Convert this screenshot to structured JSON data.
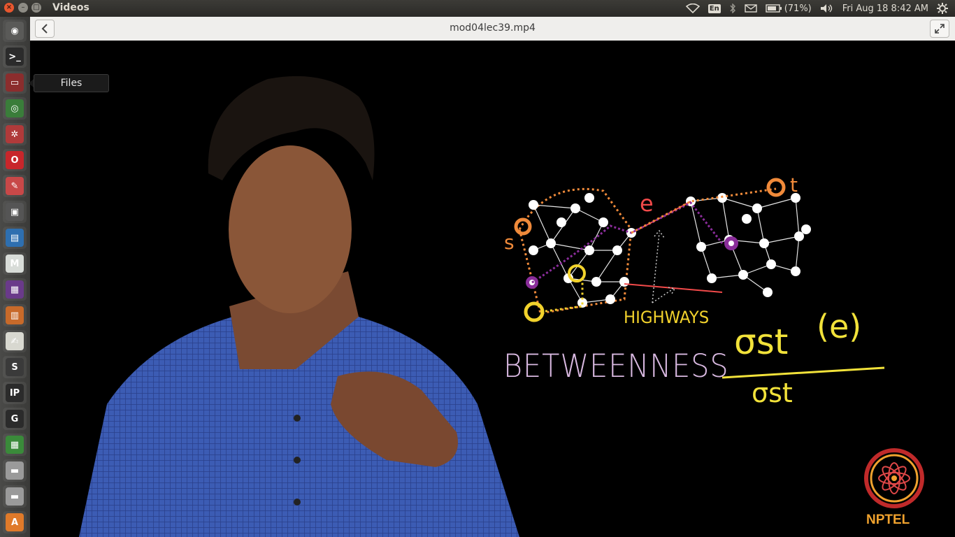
{
  "window": {
    "title": "Videos",
    "file_title": "mod04lec39.mp4"
  },
  "tray": {
    "lang": "En",
    "battery": "(71%)",
    "datetime": "Fri Aug 18  8:42 AM"
  },
  "launcher": {
    "tooltip": "Files",
    "items": [
      {
        "name": "dash-icon",
        "color": "#5a5a58",
        "glyph": "◉"
      },
      {
        "name": "terminal-icon",
        "color": "#2b2b2b",
        "glyph": ">_"
      },
      {
        "name": "files-icon",
        "color": "#8b2d2d",
        "glyph": "▭"
      },
      {
        "name": "chrome-icon",
        "color": "#3a7d3a",
        "glyph": "◎"
      },
      {
        "name": "settings-icon",
        "color": "#b03a3a",
        "glyph": "✲"
      },
      {
        "name": "opera-icon",
        "color": "#c8262b",
        "glyph": "O"
      },
      {
        "name": "pdf-reader-icon",
        "color": "#c84848",
        "glyph": "✎"
      },
      {
        "name": "video-editor-icon",
        "color": "#555555",
        "glyph": "▣"
      },
      {
        "name": "writer-icon",
        "color": "#2e6fb0",
        "glyph": "▤"
      },
      {
        "name": "gmail-icon",
        "color": "#d8dcd8",
        "glyph": "M"
      },
      {
        "name": "media-icon",
        "color": "#6a3a8a",
        "glyph": "▦"
      },
      {
        "name": "impress-icon",
        "color": "#c86a2a",
        "glyph": "▥"
      },
      {
        "name": "text-editor-icon",
        "color": "#d8d8d0",
        "glyph": "✍"
      },
      {
        "name": "sublime-icon",
        "color": "#3a3a3a",
        "glyph": "S"
      },
      {
        "name": "ipython-icon",
        "color": "#2b2b2b",
        "glyph": "IP"
      },
      {
        "name": "gephi-icon",
        "color": "#2b2b2b",
        "glyph": "G"
      },
      {
        "name": "calc-icon",
        "color": "#3a8a3a",
        "glyph": "▦"
      },
      {
        "name": "drive-icon",
        "color": "#9a9a9a",
        "glyph": "▬"
      },
      {
        "name": "drive2-icon",
        "color": "#9a9a9a",
        "glyph": "▬"
      },
      {
        "name": "software-center-icon",
        "color": "#e07a2a",
        "glyph": "A"
      }
    ]
  },
  "video": {
    "title_word": "BETWEENNESS",
    "label_highways": "HIGHWAYS",
    "numerator": "σst",
    "numerator_arg": "(e)",
    "denominator": "σst",
    "node_s": "s",
    "node_t": "t",
    "edge_label": "e",
    "logo": "NPTEL"
  },
  "colors": {
    "accent_orange": "#f08a3a",
    "purple": "#8a2d9a",
    "yellow": "#f2d22c",
    "shirt": "#3b5fb8"
  }
}
